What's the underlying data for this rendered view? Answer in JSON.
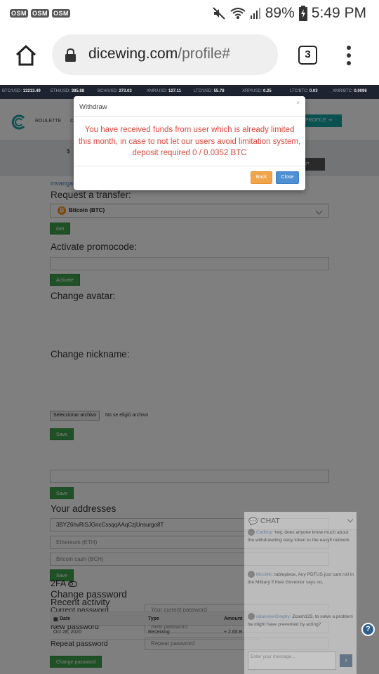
{
  "statusbar": {
    "notifications": [
      "OSM",
      "OSM",
      "OSM"
    ],
    "battery": "89%",
    "time": "5:49 PM"
  },
  "browser": {
    "url_host": "dicewing.com",
    "url_path": "/profile#",
    "tab_count": "3"
  },
  "ticker": [
    {
      "pair": "BTC/USD:",
      "value": "13213.49"
    },
    {
      "pair": "ETH/USD:",
      "value": "385.88"
    },
    {
      "pair": "BCH/USD:",
      "value": "273.03"
    },
    {
      "pair": "XMR/USD:",
      "value": "127.11"
    },
    {
      "pair": "LTC/USD:",
      "value": "55.78"
    },
    {
      "pair": "XRP/USD:",
      "value": "0.25"
    },
    {
      "pair": "LTC/BTC:",
      "value": "0.03"
    },
    {
      "pair": "XMR/BTC:",
      "value": "0.0096"
    }
  ],
  "site": {
    "nav_roulette": "ROULETTE",
    "nav_partial": "C",
    "profile_button": "PROFILE",
    "band_text": "$",
    "band_button": "ER",
    "username_partial": "mvanga"
  },
  "transfer": {
    "heading": "Request a transfer:",
    "coin": "Bitcoin (BTC)",
    "button": "Get"
  },
  "promo": {
    "heading": "Activate promocode:",
    "button": "Activate"
  },
  "avatar": {
    "heading": "Change avatar:",
    "file_button": "Seleccionar archivo",
    "file_status": "No se eligió archivo",
    "button": "Save"
  },
  "nickname": {
    "heading": "Change nickname:",
    "button": "Save"
  },
  "addresses": {
    "heading": "Your addresses",
    "btc_value": "3BYZ6hvRiSJGncCssqqAAqCzjUnsurgo8T",
    "eth_placeholder": "Ethereum (ETH)",
    "bch_placeholder": "Bitcoin cash (BCH)",
    "button": "Save"
  },
  "password": {
    "heading": "Change password",
    "current_label": "Current password",
    "current_placeholder": "Your current password",
    "new_label": "New password",
    "new_placeholder": "New password",
    "repeat_label": "Repeat password",
    "repeat_placeholder": "Repeat password",
    "button": "Change password"
  },
  "twofa": {
    "label": "2FA"
  },
  "activity": {
    "heading": "Recent activity",
    "columns": [
      "Date",
      "Type",
      "Amount"
    ],
    "rows": [
      {
        "date": "Oct 28, 2020",
        "type": "Receiving",
        "amount": "+ 2.65 B"
      }
    ]
  },
  "chat": {
    "title": "CHAT",
    "messages": [
      {
        "name": "Cadboy:",
        "text": "hey, does anyone know much about the withdrawiling easy token to the easyfi network"
      },
      {
        "name": "Mockkk:",
        "text": "tablepiece, Any PDTUS just cant roll in the Military if thee Governor says no."
      },
      {
        "name": "odanskerDinghy:",
        "text": "Zcash123, to solve a problem he might have prevented by acting?"
      }
    ],
    "input_placeholder": "Enter your message..."
  },
  "modal": {
    "title": "Withdraw",
    "close": "×",
    "message": "You have received funds from user which is already limited this month, in case to not let our users avoid limitation system, deposit required 0 / 0.0352 BTC",
    "back_button": "Back",
    "close_button": "Close"
  },
  "help": "?",
  "colors": {
    "accent_teal": "#17a2a0",
    "success_green": "#3fa34d",
    "error_red": "#e0473a",
    "back_orange": "#f2a44a",
    "close_blue": "#4f8fd4"
  }
}
